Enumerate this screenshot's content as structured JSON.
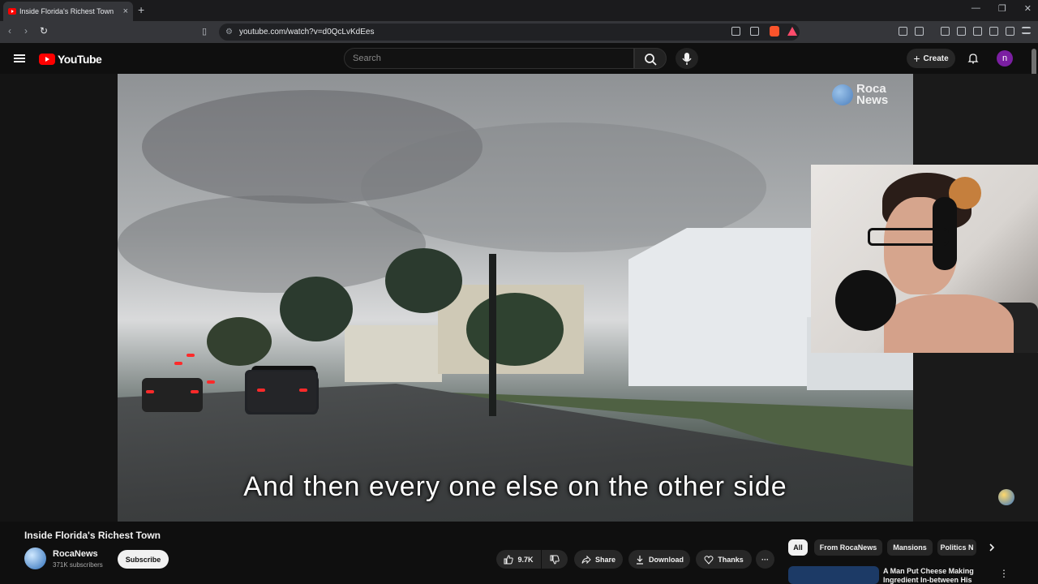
{
  "browser": {
    "tab_title": "Inside Florida's Richest Town",
    "tab_close": "×",
    "new_tab": "+",
    "url": "youtube.com/watch?v=d0QcLvKdEes",
    "window_controls": [
      "—",
      "❐",
      "✕"
    ]
  },
  "youtube": {
    "logo_text": "YouTube",
    "search_placeholder": "Search",
    "create_label": "Create",
    "avatar_letter": "n"
  },
  "player": {
    "caption": "And then every one else on the other side",
    "watermark_text": "Roca News"
  },
  "video": {
    "title": "Inside Florida's Richest Town",
    "channel_name": "RocaNews",
    "subscribers": "371K subscribers",
    "subscribe_label": "Subscribe",
    "likes": "9.7K",
    "share_label": "Share",
    "download_label": "Download",
    "thanks_label": "Thanks",
    "more_label": "···"
  },
  "chips": [
    {
      "label": "All",
      "active": true
    },
    {
      "label": "From RocaNews",
      "active": false
    },
    {
      "label": "Mansions",
      "active": false
    },
    {
      "label": "Politics N",
      "active": false
    }
  ],
  "recommendation": {
    "title": "A Man Put Cheese Making Ingredient In-between His Leg..."
  }
}
